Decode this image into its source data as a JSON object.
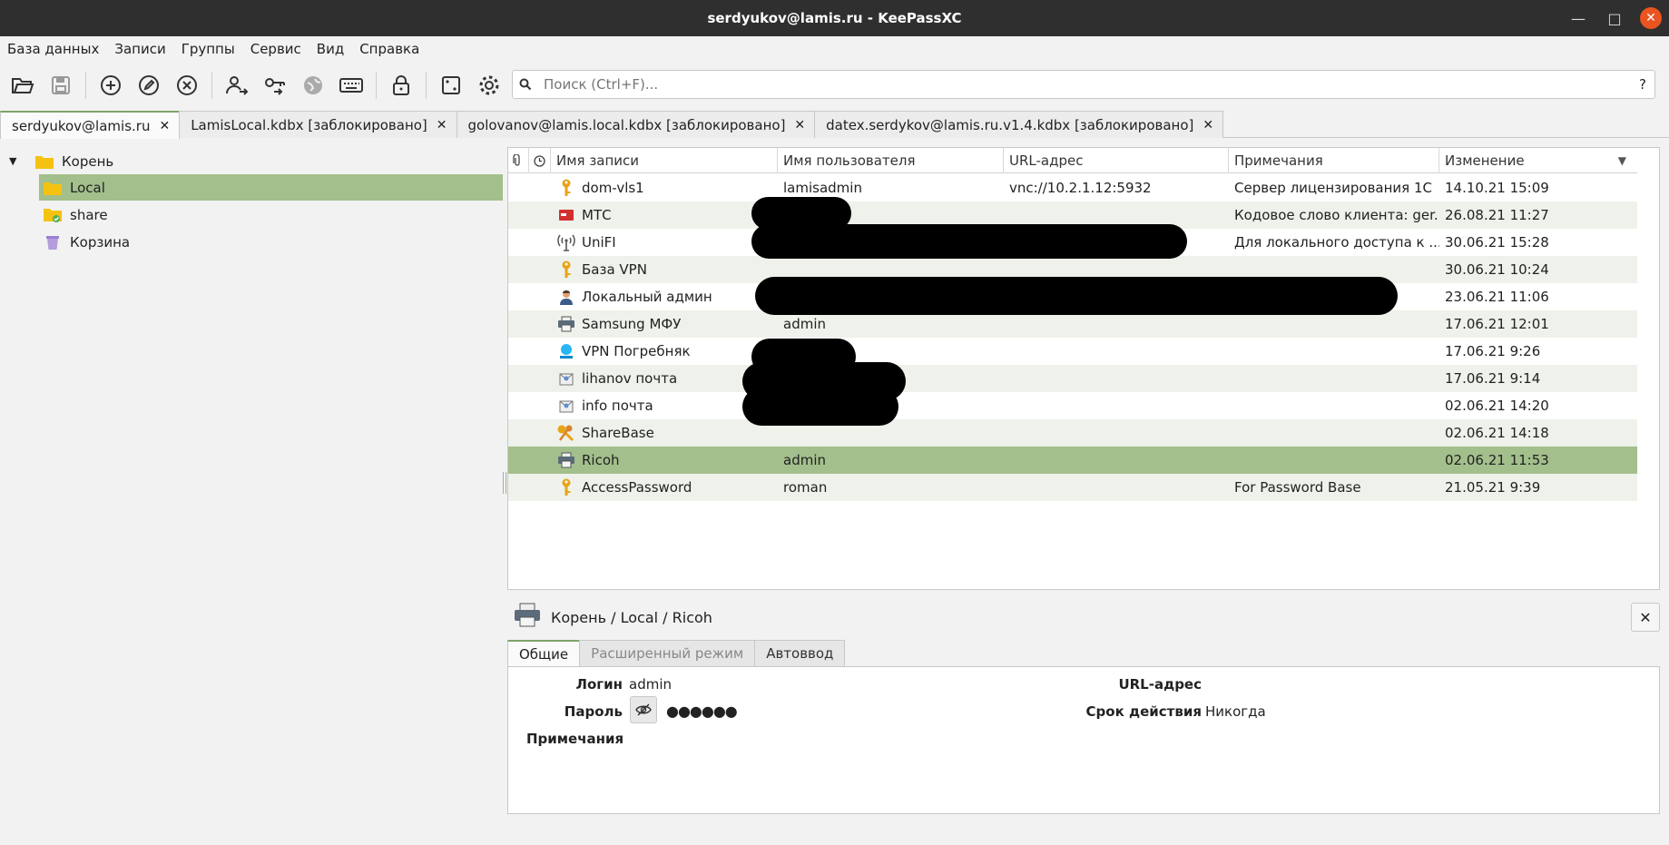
{
  "window": {
    "title": "serdyukov@lamis.ru - KeePassXC"
  },
  "menu": [
    "База данных",
    "Записи",
    "Группы",
    "Сервис",
    "Вид",
    "Справка"
  ],
  "search": {
    "placeholder": "Поиск (Ctrl+F)...",
    "help": "?"
  },
  "doc_tabs": [
    {
      "label": "serdyukov@lamis.ru",
      "active": true
    },
    {
      "label": "LamisLocal.kdbx [заблокировано]"
    },
    {
      "label": "golovanov@lamis.local.kdbx [заблокировано]"
    },
    {
      "label": "datex.serdykov@lamis.ru.v1.4.kdbx [заблокировано]"
    }
  ],
  "tree": {
    "root": "Корень",
    "local": "Local",
    "share": "share",
    "trash": "Корзина"
  },
  "table": {
    "headers": {
      "name": "Имя записи",
      "user": "Имя пользователя",
      "url": "URL-адрес",
      "notes": "Примечания",
      "modified": "Изменение"
    },
    "rows": [
      {
        "icon": "key-icon",
        "name": "dom-vls1",
        "user": "lamisadmin",
        "url": "vnc://10.2.1.12:5932",
        "notes": "Сервер лицензирования 1С",
        "modified": "14.10.21 15:09"
      },
      {
        "icon": "card-icon",
        "name": "МТС",
        "user": "",
        "url": "",
        "notes": "Кодовое слово клиента: ger...",
        "modified": "26.08.21 11:27"
      },
      {
        "icon": "antenna-icon",
        "name": "UniFI",
        "user": "",
        "url": "",
        "notes": "Для локального доступа к ...",
        "modified": "30.06.21 15:28"
      },
      {
        "icon": "key-icon",
        "name": "База VPN",
        "user": "",
        "url": "",
        "notes": "",
        "modified": "30.06.21 10:24"
      },
      {
        "icon": "user-icon",
        "name": "Локальный админ",
        "user": "",
        "url": "",
        "notes": "",
        "modified": "23.06.21 11:06"
      },
      {
        "icon": "printer-icon",
        "name": "Samsung МФУ",
        "user": "admin",
        "url": "",
        "notes": "",
        "modified": "17.06.21 12:01"
      },
      {
        "icon": "network-icon",
        "name": "VPN Погребняк",
        "user": "",
        "url": "",
        "notes": "",
        "modified": "17.06.21 9:26"
      },
      {
        "icon": "mail-icon",
        "name": "lihanov почта",
        "user": "",
        "url": "",
        "notes": "",
        "modified": "17.06.21 9:14"
      },
      {
        "icon": "mail-icon",
        "name": "info почта",
        "user": "",
        "url": "",
        "notes": "",
        "modified": "02.06.21 14:20"
      },
      {
        "icon": "keys-icon",
        "name": "ShareBase",
        "user": "",
        "url": "",
        "notes": "",
        "modified": "02.06.21 14:18"
      },
      {
        "icon": "printer-icon",
        "name": "Ricoh",
        "user": "admin",
        "url": "",
        "notes": "",
        "modified": "02.06.21 11:53"
      },
      {
        "icon": "key-icon",
        "name": "AccessPassword",
        "user": "roman",
        "url": "",
        "notes": "For Password Base",
        "modified": "21.05.21 9:39"
      }
    ]
  },
  "details": {
    "breadcrumb": "Корень / Local / Ricoh",
    "tabs": [
      "Общие",
      "Расширенный режим",
      "Автоввод"
    ],
    "login_label": "Логин",
    "login_value": "admin",
    "password_label": "Пароль",
    "password_value": "●●●●●●",
    "notes_label": "Примечания",
    "url_label": "URL-адрес",
    "expiry_label": "Срок действия",
    "expiry_value": "Никогда"
  },
  "colors": {
    "selection": "#a3bf8c",
    "titlebar": "#2f2f2f",
    "close": "#e95420"
  }
}
